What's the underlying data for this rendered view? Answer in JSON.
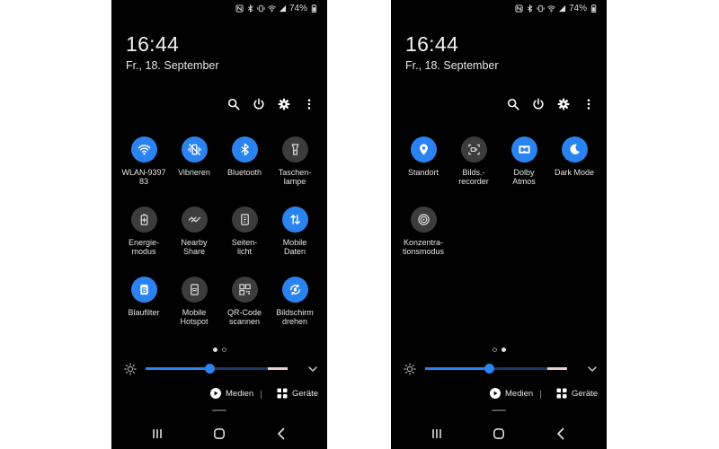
{
  "status": {
    "battery": "74%"
  },
  "clock": "16:44",
  "date": "Fr., 18. September",
  "icons": [
    "search-icon",
    "power-icon",
    "gear-icon",
    "more-vertical-icon"
  ],
  "colors": {
    "accent": "#2a83f0",
    "tile_off": "#3c3c3c",
    "background": "#000000"
  },
  "left_panel": {
    "tiles": [
      {
        "label": "WLAN-9397\n83",
        "icon": "wifi-icon",
        "active": true
      },
      {
        "label": "Vibrieren",
        "icon": "vibrate-icon",
        "active": true
      },
      {
        "label": "Bluetooth",
        "icon": "bluetooth-icon",
        "active": true
      },
      {
        "label": "Taschen-\nlampe",
        "icon": "flashlight-icon",
        "active": false
      },
      {
        "label": "Energie-\nmodus",
        "icon": "battery-saver-icon",
        "active": false
      },
      {
        "label": "Nearby\nShare",
        "icon": "nearby-share-icon",
        "active": false
      },
      {
        "label": "Seiten-\nlicht",
        "icon": "edge-lighting-icon",
        "active": false
      },
      {
        "label": "Mobile\nDaten",
        "icon": "mobile-data-icon",
        "active": true
      },
      {
        "label": "Blaufilter",
        "icon": "blue-light-filter-icon",
        "active": true
      },
      {
        "label": "Mobile\nHotspot",
        "icon": "hotspot-icon",
        "active": false
      },
      {
        "label": "QR-Code\nscannen",
        "icon": "qr-code-icon",
        "active": false
      },
      {
        "label": "Bildschirm\ndrehen",
        "icon": "auto-rotate-icon",
        "active": true
      }
    ],
    "page": 1
  },
  "right_panel": {
    "tiles": [
      {
        "label": "Standort",
        "icon": "location-icon",
        "active": true
      },
      {
        "label": "Bilds.-\nrecorder",
        "icon": "screen-recorder-icon",
        "active": false
      },
      {
        "label": "Dolby\nAtmos",
        "icon": "dolby-icon",
        "active": true
      },
      {
        "label": "Dark Mode",
        "icon": "moon-icon",
        "active": true
      },
      {
        "label": "Konzentra-\ntionsmodus",
        "icon": "focus-mode-icon",
        "active": false
      }
    ],
    "page": 2
  },
  "brightness": {
    "level_percent": 45
  },
  "media": {
    "media_label": "Medien",
    "devices_label": "Geräte"
  },
  "navigation": [
    "recent-apps-icon",
    "home-icon",
    "back-icon"
  ]
}
